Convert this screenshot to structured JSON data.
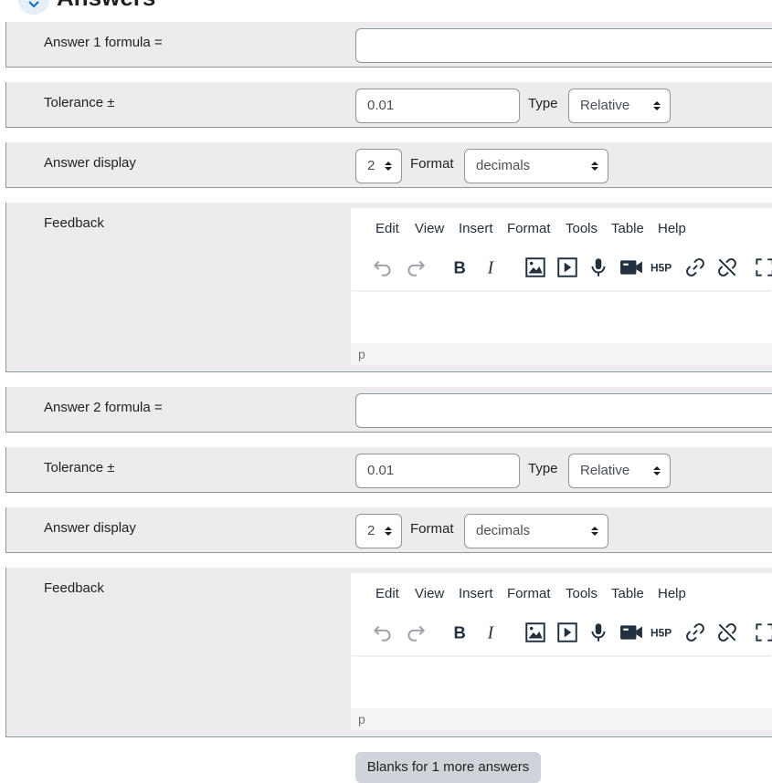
{
  "section": {
    "title": "Answers"
  },
  "answers": [
    {
      "formula_label": "Answer 1 formula =",
      "formula_value": "",
      "tolerance_label": "Tolerance ±",
      "tolerance_value": "0.01",
      "type_label": "Type",
      "type_value": "Relative",
      "display_label": "Answer display",
      "display_value": "2",
      "format_label": "Format",
      "format_value": "decimals",
      "feedback_label": "Feedback",
      "editor_status": "p"
    },
    {
      "formula_label": "Answer 2 formula =",
      "formula_value": "",
      "tolerance_label": "Tolerance ±",
      "tolerance_value": "0.01",
      "type_label": "Type",
      "type_value": "Relative",
      "display_label": "Answer display",
      "display_value": "2",
      "format_label": "Format",
      "format_value": "decimals",
      "feedback_label": "Feedback",
      "editor_status": "p"
    }
  ],
  "editor_menu": [
    "Edit",
    "View",
    "Insert",
    "Format",
    "Tools",
    "Table",
    "Help"
  ],
  "editor_toolbar_icons": [
    "undo-icon",
    "redo-icon",
    "bold-icon",
    "italic-icon",
    "image-icon",
    "media-icon",
    "record-audio-icon",
    "record-video-icon",
    "h5p-icon",
    "link-icon",
    "unlink-icon",
    "fullscreen-icon"
  ],
  "more_button": "Blanks for 1 more answers",
  "colors": {
    "row_bg": "#ececec",
    "border": "#8f959e",
    "accent": "#0f6cbf"
  }
}
